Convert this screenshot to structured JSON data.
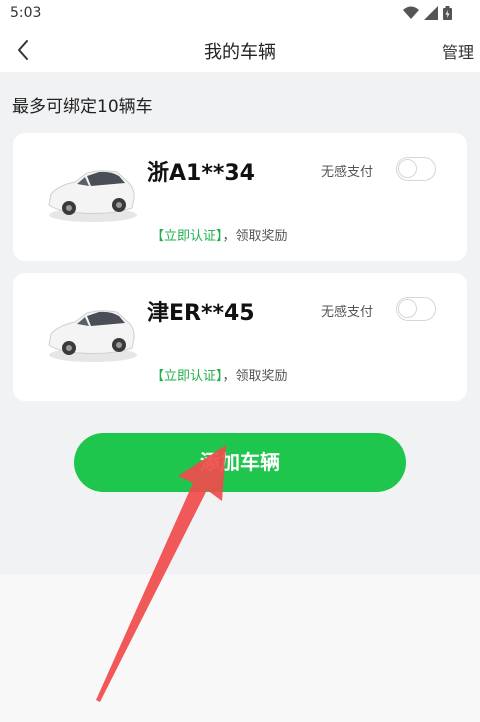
{
  "status_bar": {
    "time": "5:03",
    "icons": [
      "wifi-icon",
      "signal-icon",
      "battery-icon"
    ]
  },
  "nav": {
    "title": "我的车辆",
    "manage_label": "管理",
    "back_icon": "chevron-left-icon"
  },
  "limit_text": "最多可绑定10辆车",
  "vehicles": [
    {
      "plate": "浙A1**34",
      "pay_label": "无感支付",
      "pay_enabled": false,
      "verify_link": "【立即认证】",
      "verify_suffix": "，领取奖励"
    },
    {
      "plate": "津ER**45",
      "pay_label": "无感支付",
      "pay_enabled": false,
      "verify_link": "【立即认证】",
      "verify_suffix": "，领取奖励"
    }
  ],
  "add_button_label": "添加车辆",
  "colors": {
    "accent_green": "#1fc64d",
    "verify_green": "#20b04b",
    "arrow_red": "#f04b4b",
    "page_bg": "#f1f2f4"
  }
}
